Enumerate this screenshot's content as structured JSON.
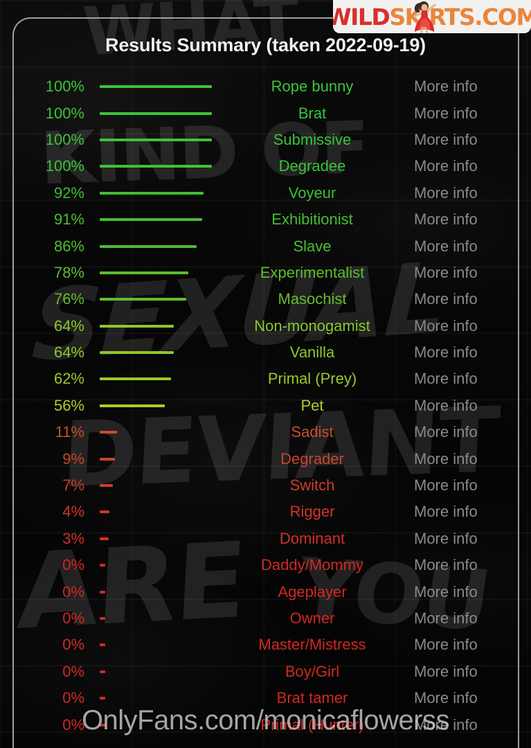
{
  "title": "Results Summary (taken 2022-09-19)",
  "more_info_label": "More info",
  "colors": {
    "high": "#3ac43a",
    "mid": "#9ec82a",
    "low": "#c8442a",
    "more_info": "#8a8a8a",
    "title": "#f2f2f2",
    "frame": "#c8cacd",
    "logo_red": "#d8302a",
    "logo_orange": "#e8863c"
  },
  "logo": {
    "part1": "WILD",
    "part2": "SKIRTS.COM",
    "dancer_icon": "dancing-girl-icon"
  },
  "watermark": "OnlyFans.com/monicaflowerss",
  "graffiti": {
    "l1": "WHAT",
    "l2": "KIND OF",
    "l3": "SEXUAL",
    "l4": "DEVIANT",
    "l5": "ARE",
    "l6": "YOU"
  },
  "chart_data": {
    "type": "bar",
    "title": "Results Summary (taken 2022-09-19)",
    "xlabel": "",
    "ylabel": "",
    "xlim": [
      0,
      100
    ],
    "grid": false,
    "legend": "none",
    "orientation": "horizontal",
    "unit": "%",
    "categories": [
      "Rope bunny",
      "Brat",
      "Submissive",
      "Degradee",
      "Voyeur",
      "Exhibitionist",
      "Slave",
      "Experimentalist",
      "Masochist",
      "Non-monogamist",
      "Vanilla",
      "Primal (Prey)",
      "Pet",
      "Sadist",
      "Degrader",
      "Switch",
      "Rigger",
      "Dominant",
      "Daddy/Mommy",
      "Ageplayer",
      "Owner",
      "Master/Mistress",
      "Boy/Girl",
      "Brat tamer",
      "Primal (Hunter)"
    ],
    "values": [
      100,
      100,
      100,
      100,
      92,
      91,
      86,
      78,
      76,
      64,
      64,
      62,
      56,
      11,
      9,
      7,
      4,
      3,
      0,
      0,
      0,
      0,
      0,
      0,
      0
    ],
    "rows": [
      {
        "pct": "100%",
        "value": 100,
        "label": "Rope bunny",
        "color": "#3ac43a",
        "more": "More info"
      },
      {
        "pct": "100%",
        "value": 100,
        "label": "Brat",
        "color": "#3ac43a",
        "more": "More info"
      },
      {
        "pct": "100%",
        "value": 100,
        "label": "Submissive",
        "color": "#3ac43a",
        "more": "More info"
      },
      {
        "pct": "100%",
        "value": 100,
        "label": "Degradee",
        "color": "#3ac43a",
        "more": "More info"
      },
      {
        "pct": "92%",
        "value": 92,
        "label": "Voyeur",
        "color": "#3ebe33",
        "more": "More info"
      },
      {
        "pct": "91%",
        "value": 91,
        "label": "Exhibitionist",
        "color": "#46be31",
        "more": "More info"
      },
      {
        "pct": "86%",
        "value": 86,
        "label": "Slave",
        "color": "#4dbe2f",
        "more": "More info"
      },
      {
        "pct": "78%",
        "value": 78,
        "label": "Experimentalist",
        "color": "#5cbe2e",
        "more": "More info"
      },
      {
        "pct": "76%",
        "value": 76,
        "label": "Masochist",
        "color": "#63bd2e",
        "more": "More info"
      },
      {
        "pct": "64%",
        "value": 64,
        "label": "Non-monogamist",
        "color": "#8ec82b",
        "more": "More info"
      },
      {
        "pct": "64%",
        "value": 64,
        "label": "Vanilla",
        "color": "#8ec82b",
        "more": "More info"
      },
      {
        "pct": "62%",
        "value": 62,
        "label": "Primal (Prey)",
        "color": "#9ac92a",
        "more": "More info"
      },
      {
        "pct": "56%",
        "value": 56,
        "label": "Pet",
        "color": "#b0cd28",
        "more": "More info"
      },
      {
        "pct": "11%",
        "value": 11,
        "label": "Sadist",
        "color": "#c84f2e",
        "more": "More info"
      },
      {
        "pct": "9%",
        "value": 9,
        "label": "Degrader",
        "color": "#c8452c",
        "more": "More info"
      },
      {
        "pct": "7%",
        "value": 7,
        "label": "Switch",
        "color": "#cc3e2a",
        "more": "More info"
      },
      {
        "pct": "4%",
        "value": 4,
        "label": "Rigger",
        "color": "#cf3528",
        "more": "More info"
      },
      {
        "pct": "3%",
        "value": 3,
        "label": "Dominant",
        "color": "#d03026",
        "more": "More info"
      },
      {
        "pct": "0%",
        "value": 0,
        "label": "Daddy/Mommy",
        "color": "#d22823",
        "more": "More info"
      },
      {
        "pct": "0%",
        "value": 0,
        "label": "Ageplayer",
        "color": "#d22823",
        "more": "More info"
      },
      {
        "pct": "0%",
        "value": 0,
        "label": "Owner",
        "color": "#d22823",
        "more": "More info"
      },
      {
        "pct": "0%",
        "value": 0,
        "label": "Master/Mistress",
        "color": "#d22823",
        "more": "More info"
      },
      {
        "pct": "0%",
        "value": 0,
        "label": "Boy/Girl",
        "color": "#d22823",
        "more": "More info"
      },
      {
        "pct": "0%",
        "value": 0,
        "label": "Brat tamer",
        "color": "#d22823",
        "more": "More info"
      },
      {
        "pct": "0%",
        "value": 0,
        "label": "Primal (Hunter)",
        "color": "#d22823",
        "more": "More info"
      }
    ]
  }
}
